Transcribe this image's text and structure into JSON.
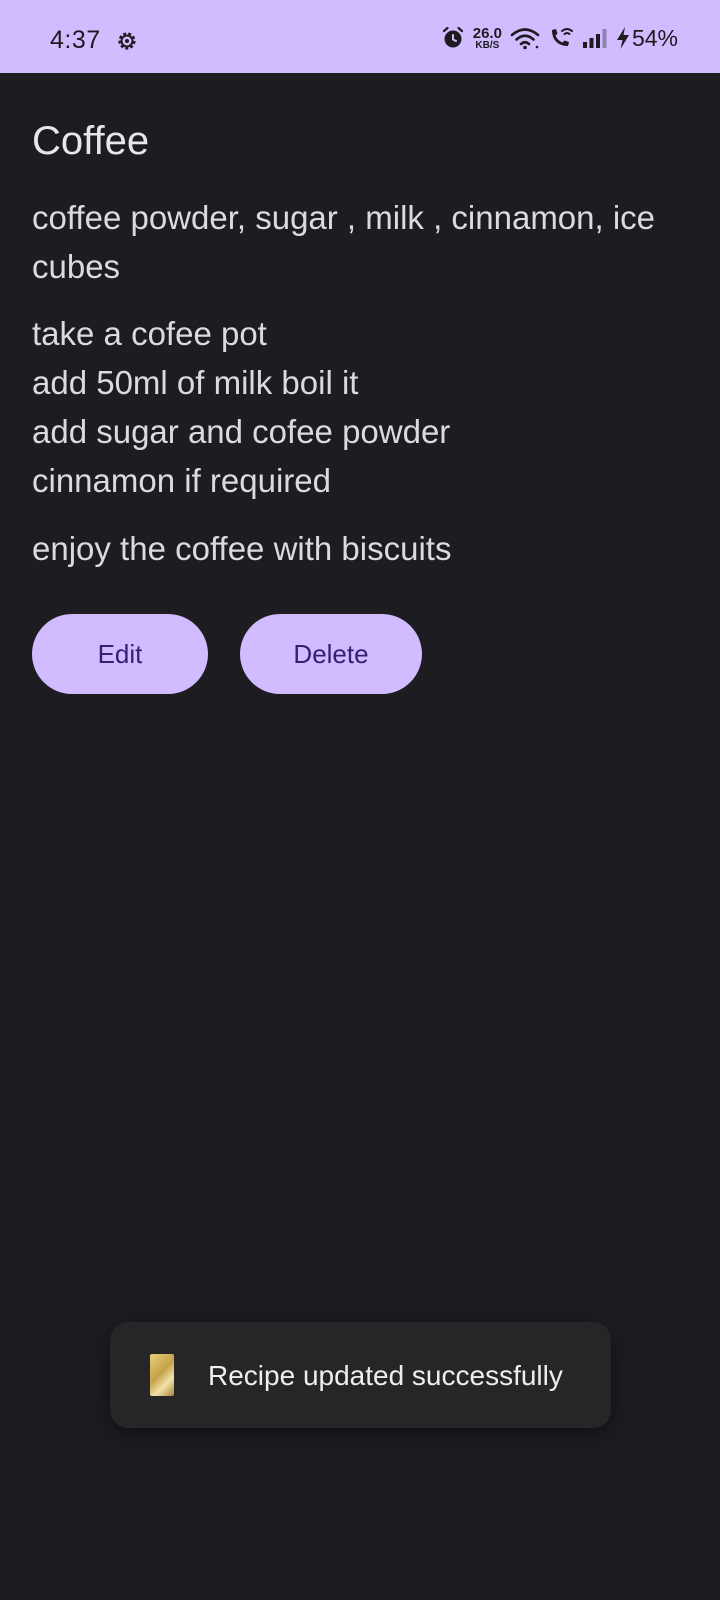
{
  "status_bar": {
    "time": "4:37",
    "net_speed_value": "26.0",
    "net_speed_unit": "KB/S",
    "battery": "54%",
    "icons": [
      "settings-gear-icon",
      "alarm-icon",
      "wifi-icon",
      "wifi-calling-icon",
      "signal-icon",
      "battery-charging-icon"
    ]
  },
  "recipe": {
    "title": "Coffee",
    "ingredients": "coffee powder, sugar , milk , cinnamon, ice cubes",
    "steps": [
      "take a cofee pot",
      "add 50ml of milk boil it",
      "add sugar and cofee powder",
      "cinnamon if required"
    ],
    "note": "enjoy the coffee with biscuits"
  },
  "actions": {
    "edit_label": "Edit",
    "delete_label": "Delete"
  },
  "toast": {
    "message": "Recipe updated successfully",
    "icon": "app-icon"
  },
  "colors": {
    "accent": "#d0bcff",
    "background": "#1d1c21",
    "button_text": "#381e72"
  }
}
